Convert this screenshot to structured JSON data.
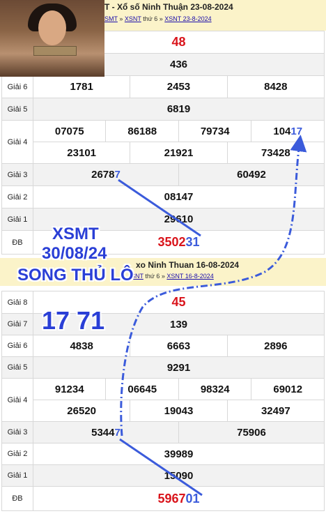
{
  "draw1": {
    "header_title": "T - Xổ số Ninh Thuận 23-08-2024",
    "crumb_a": "SMT",
    "crumb_sep1": " » ",
    "crumb_b": "XSNT",
    "crumb_mid": " thứ 6 » ",
    "crumb_c": "XSNT 23-8-2024",
    "rows": {
      "g8": "48",
      "g7": "436",
      "g6": [
        "1781",
        "2453",
        "8428"
      ],
      "g5": "6819",
      "g4a": [
        "07075",
        "86188",
        "79734"
      ],
      "g4a_last_prefix": "104",
      "g4a_last_hl": "17",
      "g4b": [
        "23101",
        "21921",
        "73428"
      ],
      "g3_first_prefix": "2678",
      "g3_first_hl": "7",
      "g3_second": "60492",
      "g2": "08147",
      "g1": "29610",
      "db_prefix": "3502",
      "db_hl": "31"
    },
    "labels": {
      "g6": "Giải 6",
      "g5": "Giải 5",
      "g4": "Giải 4",
      "g3": "Giải 3",
      "g2": "Giải 2",
      "g1": "Giải 1",
      "db": "ĐB"
    }
  },
  "draw2": {
    "header_title": "xo Ninh Thuan 16-08-2024",
    "crumb_a": "SNT",
    "crumb_mid": " thứ 6 » ",
    "crumb_c": "XSNT 16-8-2024",
    "rows": {
      "g8": "45",
      "g7": "139",
      "g6": [
        "4838",
        "6663",
        "2896"
      ],
      "g5": "9291",
      "g4a": [
        "91234",
        "06645",
        "98324",
        "69012"
      ],
      "g4b": [
        "26520",
        "19043",
        "32497"
      ],
      "g3_first_prefix": "5344",
      "g3_first_hl": "7",
      "g3_second": "75906",
      "g2": "39989",
      "g1": "15090",
      "db_prefix": "5967",
      "db_hl": "01"
    },
    "labels": {
      "g8": "Giải 8",
      "g7": "Giải 7",
      "g6": "Giải 6",
      "g5": "Giải 5",
      "g4": "Giải 4",
      "g3": "Giải 3",
      "g2": "Giải 2",
      "g1": "Giải 1",
      "db": "ĐB"
    }
  },
  "overlay": {
    "line1": "XSMT",
    "line2": "30/08/24",
    "line3": "SONG THỦ LÔ",
    "pair": "17 71"
  },
  "colors": {
    "accent_blue": "#3b5bdb",
    "special_red": "#d9141b",
    "header_bg": "#fbf3c9"
  }
}
